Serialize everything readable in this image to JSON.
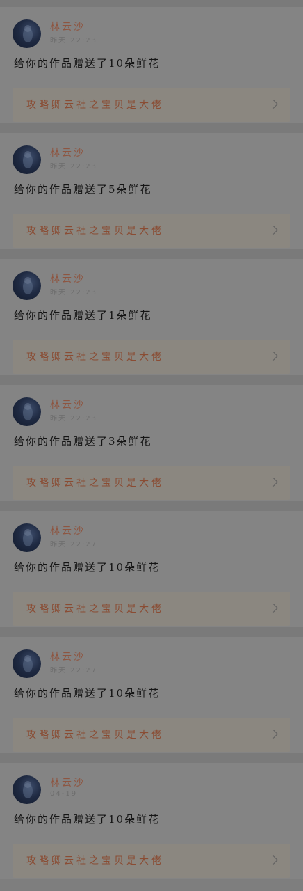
{
  "notifications": [
    {
      "user": "林云沙",
      "time": "昨天 22:23",
      "message": "给你的作品赠送了10朵鲜花",
      "link_title": "攻略卿云社之宝贝是大佬"
    },
    {
      "user": "林云沙",
      "time": "昨天 22:23",
      "message": "给你的作品赠送了5朵鲜花",
      "link_title": "攻略卿云社之宝贝是大佬"
    },
    {
      "user": "林云沙",
      "time": "昨天 22:23",
      "message": "给你的作品赠送了1朵鲜花",
      "link_title": "攻略卿云社之宝贝是大佬"
    },
    {
      "user": "林云沙",
      "time": "昨天 22:23",
      "message": "给你的作品赠送了3朵鲜花",
      "link_title": "攻略卿云社之宝贝是大佬"
    },
    {
      "user": "林云沙",
      "time": "昨天 22:27",
      "message": "给你的作品赠送了10朵鲜花",
      "link_title": "攻略卿云社之宝贝是大佬"
    },
    {
      "user": "林云沙",
      "time": "昨天 22:27",
      "message": "给你的作品赠送了10朵鲜花",
      "link_title": "攻略卿云社之宝贝是大佬"
    },
    {
      "user": "林云沙",
      "time": "04-19",
      "message": "给你的作品赠送了10朵鲜花",
      "link_title": "攻略卿云社之宝贝是大佬"
    }
  ],
  "icons": {
    "avatar": "avatar-image",
    "link_arrow": "chevron-right-icon"
  },
  "colors": {
    "username": "#8e5540",
    "link_text": "#8a4c33",
    "link_background": "#8b8780"
  }
}
